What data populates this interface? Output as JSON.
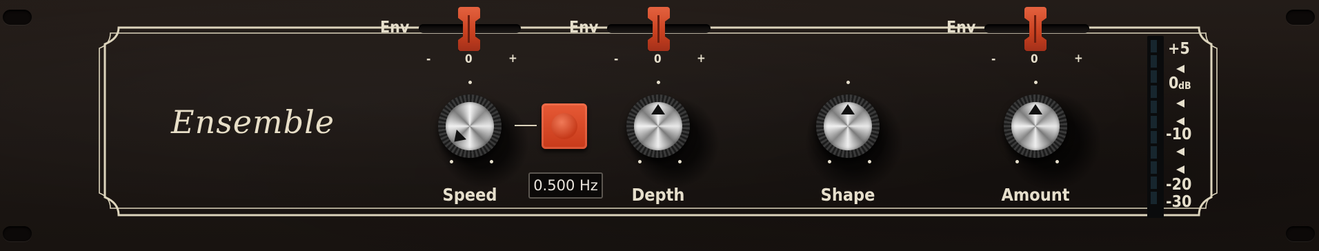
{
  "plugin": {
    "title": "Ensemble"
  },
  "env_sliders": [
    {
      "label": "Env",
      "minus": "-",
      "zero": "0",
      "plus": "+"
    },
    {
      "label": "Env",
      "minus": "-",
      "zero": "0",
      "plus": "+"
    },
    {
      "label": "Env",
      "minus": "-",
      "zero": "0",
      "plus": "+"
    }
  ],
  "controls": {
    "speed": {
      "label": "Speed",
      "readout": "0.500 Hz"
    },
    "depth": {
      "label": "Depth"
    },
    "shape": {
      "label": "Shape"
    },
    "amount": {
      "label": "Amount"
    }
  },
  "meter": {
    "labels": [
      "+5",
      "0",
      "dB",
      "-10",
      "-20",
      "-30"
    ]
  },
  "colors": {
    "panel": "#1d1714",
    "text": "#e6dfcc",
    "accent": "#d4492a"
  }
}
